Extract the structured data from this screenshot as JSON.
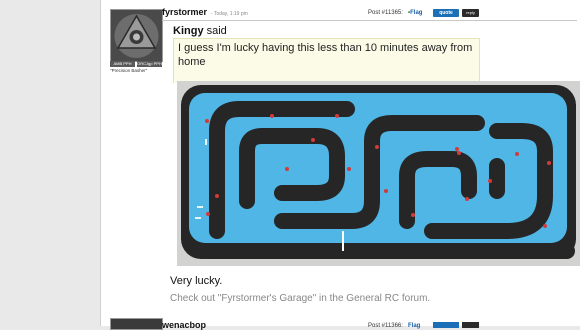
{
  "post": {
    "username": "fyrstormer",
    "date": "Today, 1:19 pm",
    "post_number": "Post #11365:",
    "flag_label": "Flag",
    "quote_label": "quote",
    "reply_label": "reply",
    "user_title": "\"Precision Basher\"",
    "avatar_badges": [
      "AMB PPH",
      "ORCJgp PPH"
    ],
    "quote": {
      "author": "Kingy",
      "said": "said",
      "text": "I guess I'm lucky having this less than 10 minutes away from home"
    },
    "image": {
      "alt": "Aerial view of RC race track",
      "colors": {
        "asphalt": "#262626",
        "infield": "#4fb6e6",
        "gravel": "#d2d2d0",
        "rumble_red": "#d33a3a"
      }
    },
    "reply_text": "Very lucky.",
    "signature": "Check out \"Fyrstormer's Garage\" in the General RC forum."
  },
  "next_post": {
    "username": "wenacbop",
    "post_number": "Post #11366:",
    "flag_label": "Flag"
  }
}
